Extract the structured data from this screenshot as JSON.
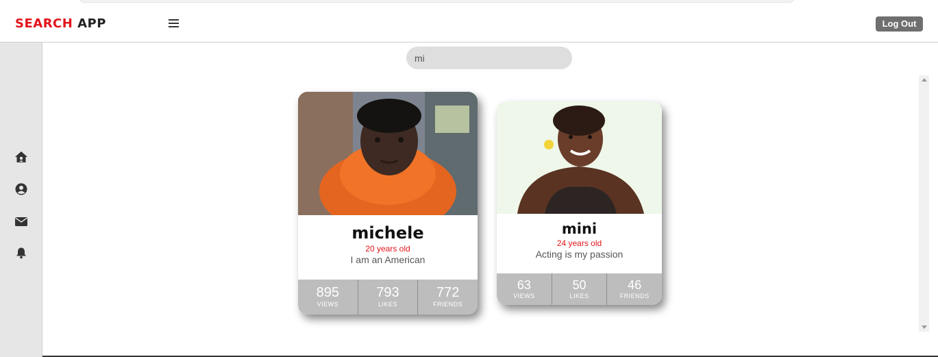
{
  "header": {
    "brand_part1": "SEARCH",
    "brand_part2": "APP",
    "logout_label": "Log Out"
  },
  "sidebar": {
    "icons": [
      "home-icon",
      "user-circle-icon",
      "envelope-icon",
      "bell-icon"
    ]
  },
  "search": {
    "value": "mi",
    "placeholder": ""
  },
  "colors": {
    "brand_red": "#e3141b",
    "stats_bg": "#bdbdbd",
    "logout_bg": "#6f6f6f"
  },
  "cards": [
    {
      "name": "michele",
      "age": "20 years old",
      "bio": "I am an American",
      "stats": [
        {
          "value": "895",
          "label": "VIEWS"
        },
        {
          "value": "793",
          "label": "LIKES"
        },
        {
          "value": "772",
          "label": "FRIENDS"
        }
      ]
    },
    {
      "name": "mini",
      "age": "24 years old",
      "bio": "Acting is my passion",
      "stats": [
        {
          "value": "63",
          "label": "VIEWS"
        },
        {
          "value": "50",
          "label": "LIKES"
        },
        {
          "value": "46",
          "label": "FRIENDS"
        }
      ]
    }
  ]
}
